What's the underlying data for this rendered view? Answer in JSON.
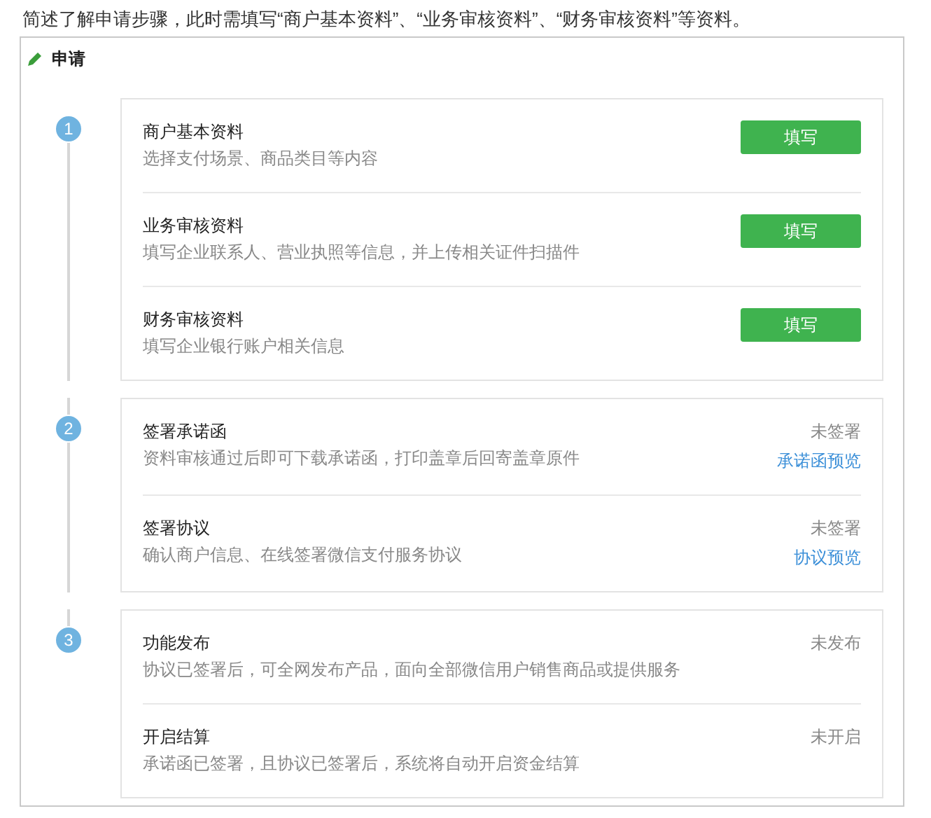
{
  "intro": "简述了解申请步骤，此时需填写“商户基本资料”、“业务审核资料”、“财务审核资料”等资料。",
  "panel": {
    "title": "申请"
  },
  "steps": [
    {
      "number": "1",
      "items": [
        {
          "title": "商户基本资料",
          "description": "选择支付场景、商品类目等内容",
          "kind": "button",
          "button": "填写"
        },
        {
          "title": "业务审核资料",
          "description": "填写企业联系人、营业执照等信息，并上传相关证件扫描件",
          "kind": "button",
          "button": "填写"
        },
        {
          "title": "财务审核资料",
          "description": "填写企业银行账户相关信息",
          "kind": "button",
          "button": "填写"
        }
      ]
    },
    {
      "number": "2",
      "items": [
        {
          "title": "签署承诺函",
          "description": "资料审核通过后即可下载承诺函，打印盖章后回寄盖章原件",
          "kind": "status",
          "status": "未签署",
          "link": "承诺函预览"
        },
        {
          "title": "签署协议",
          "description": "确认商户信息、在线签署微信支付服务协议",
          "kind": "status",
          "status": "未签署",
          "link": "协议预览"
        }
      ]
    },
    {
      "number": "3",
      "items": [
        {
          "title": "功能发布",
          "description": "协议已签署后，可全网发布产品，面向全部微信用户销售商品或提供服务",
          "kind": "status",
          "status": "未发布"
        },
        {
          "title": "开启结算",
          "description": "承诺函已签署，且协议已签署后，系统将自动开启资金结算",
          "kind": "status",
          "status": "未开启"
        }
      ]
    }
  ]
}
